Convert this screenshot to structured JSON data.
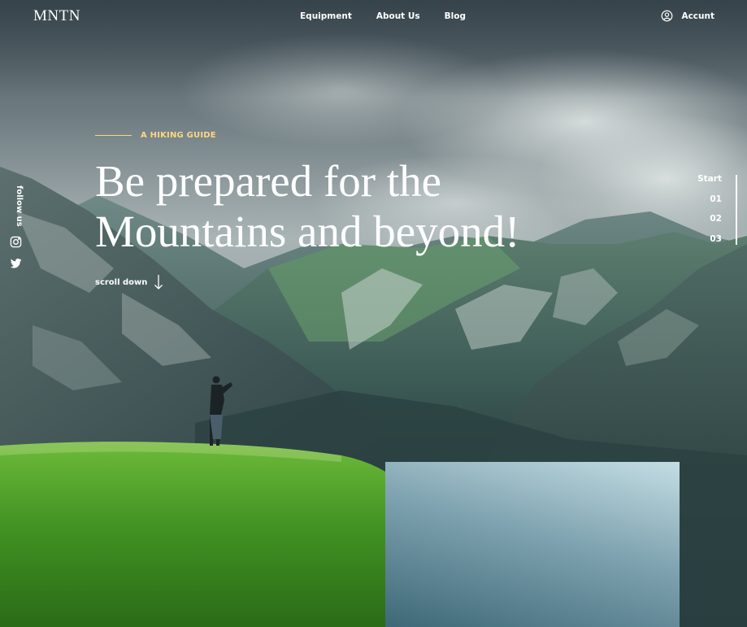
{
  "brand": {
    "logo": "MNTN"
  },
  "nav": {
    "items": [
      {
        "label": "Equipment"
      },
      {
        "label": "About Us"
      },
      {
        "label": "Blog"
      }
    ],
    "account_label": "Accunt"
  },
  "hero": {
    "eyebrow": "A HIKING GUIDE",
    "headline_line1": "Be prepared for the",
    "headline_line2": "Mountains and beyond!",
    "scroll_label": "scroll down"
  },
  "social": {
    "label": "follow us",
    "icons": [
      "instagram-icon",
      "twitter-icon"
    ]
  },
  "pager": {
    "items": [
      "Start",
      "01",
      "02",
      "03"
    ]
  },
  "colors": {
    "accent": "#FBD784",
    "text": "#FFFFFF"
  }
}
